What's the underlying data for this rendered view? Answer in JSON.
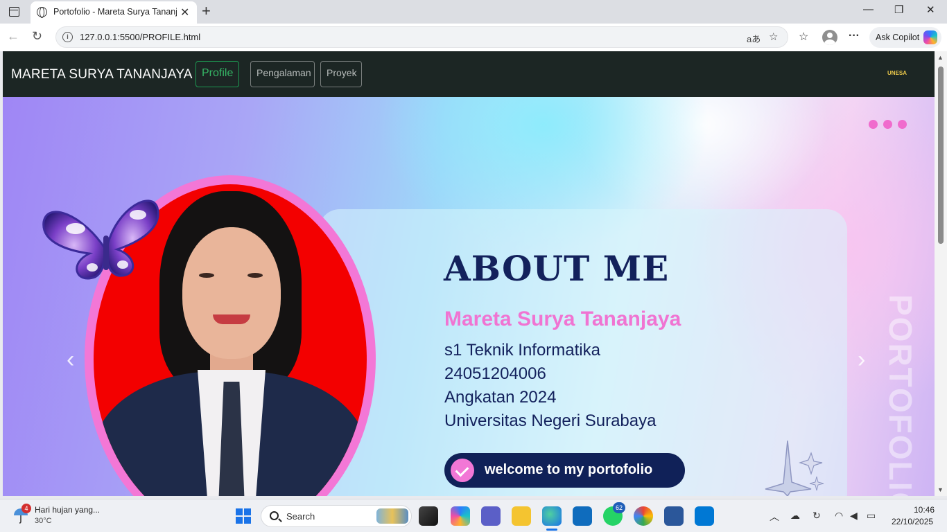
{
  "browser": {
    "tab_title": "Portofolio - Mareta Surya Tananjaya",
    "url": "127.0.0.1:5500/PROFILE.html",
    "read_aloud": "aあ",
    "copilot_label": "Ask Copilot",
    "new_tab": "+",
    "tab_close": "✕",
    "minimize": "—",
    "maximize": "❐",
    "close": "✕",
    "back": "←",
    "refresh": "↻",
    "favorite": "☆",
    "favorites_bar": "☆",
    "more": "···"
  },
  "navbar": {
    "brand": "MARETA SURYA TANANJAYA",
    "links": [
      "Profile",
      "Pengalaman",
      "Proyek"
    ],
    "logo_text": "UNESA"
  },
  "hero": {
    "title": "ABOUT ME",
    "name": "Mareta Surya Tananjaya",
    "lines": [
      "s1 Teknik Informatika",
      "24051204006",
      "Angkatan 2024",
      "Universitas Negeri Surabaya"
    ],
    "button": "welcome to my portofolio",
    "vertical_text": "PORTOFOLIO M",
    "prev": "‹",
    "next": "›"
  },
  "taskbar": {
    "weather_title": "Hari hujan yang...",
    "weather_temp": "30°C",
    "weather_badge": "4",
    "search_label": "Search",
    "whatsapp_badge": "62",
    "time": "10:46",
    "date": "22/10/2025"
  },
  "colors": {
    "navbar_bg": "#1c2624",
    "accent_pink": "#f074d2",
    "navy": "#13215c",
    "active_green": "#35b565"
  }
}
